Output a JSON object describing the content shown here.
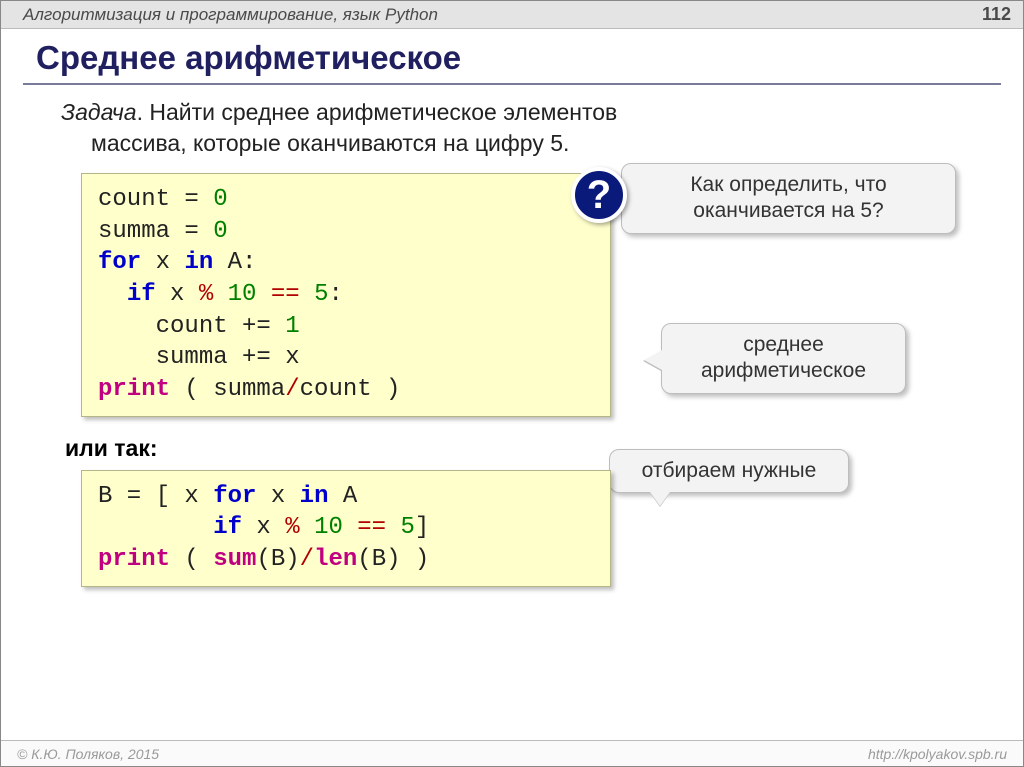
{
  "topbar": {
    "title": "Алгоритмизация и программирование, язык Python",
    "page": "112"
  },
  "heading": "Среднее арифметическое",
  "task": {
    "label": "Задача",
    "line1": ". Найти среднее арифметическое элементов",
    "line2": "массива, которые оканчиваются на цифру 5."
  },
  "code1": {
    "l1a": "count",
    "l1b": " = ",
    "l1c": "0",
    "l2a": "summa",
    "l2b": " = ",
    "l2c": "0",
    "l3a": "for",
    "l3b": " x ",
    "l3c": "in",
    "l3d": " A:",
    "l4pad": "  ",
    "l4a": "if",
    "l4b": " x ",
    "l4c": "%",
    "l4d": " ",
    "l4e": "10",
    "l4f": " ",
    "l4g": "==",
    "l4h": " ",
    "l4i": "5",
    "l4j": ":",
    "l5pad": "    ",
    "l5a": "count",
    "l5b": " += ",
    "l5c": "1",
    "l6pad": "    ",
    "l6a": "summa",
    "l6b": " += ",
    "l6c": "x",
    "l7a": "print",
    "l7b": " ( summa",
    "l7c": "/",
    "l7d": "count )"
  },
  "subhead": "или так:",
  "code2": {
    "l1a": "B",
    "l1b": " = [ x ",
    "l1c": "for",
    "l1d": " x ",
    "l1e": "in",
    "l1f": " A",
    "l2pad": "        ",
    "l2a": "if",
    "l2b": " x ",
    "l2c": "%",
    "l2d": " ",
    "l2e": "10",
    "l2f": " ",
    "l2g": "==",
    "l2h": " ",
    "l2i": "5",
    "l2j": "]",
    "l3a": "print",
    "l3b": " ( ",
    "l3c": "sum",
    "l3d": "(B)",
    "l3e": "/",
    "l3f": "len",
    "l3g": "(B) )"
  },
  "callouts": {
    "q_line1": "Как определить, что",
    "q_line2": "оканчивается на 5?",
    "avg_line1": "среднее",
    "avg_line2": "арифметическое",
    "pick": "отбираем нужные"
  },
  "qmark": "?",
  "footer": {
    "left": "© К.Ю. Поляков, 2015",
    "right": "http://kpolyakov.spb.ru"
  }
}
